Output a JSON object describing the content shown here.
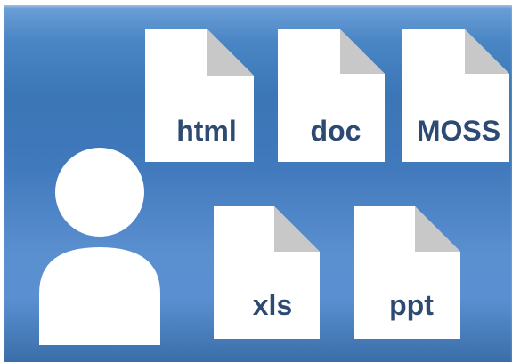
{
  "file_icons": [
    {
      "label": "html"
    },
    {
      "label": "doc"
    },
    {
      "label": "MOSS"
    },
    {
      "label": "xls"
    },
    {
      "label": "ppt"
    }
  ],
  "colors": {
    "panel": "#3f7abb",
    "page": "#ffffff",
    "fold": "#c8c8c8",
    "label": "#2d4a72"
  }
}
